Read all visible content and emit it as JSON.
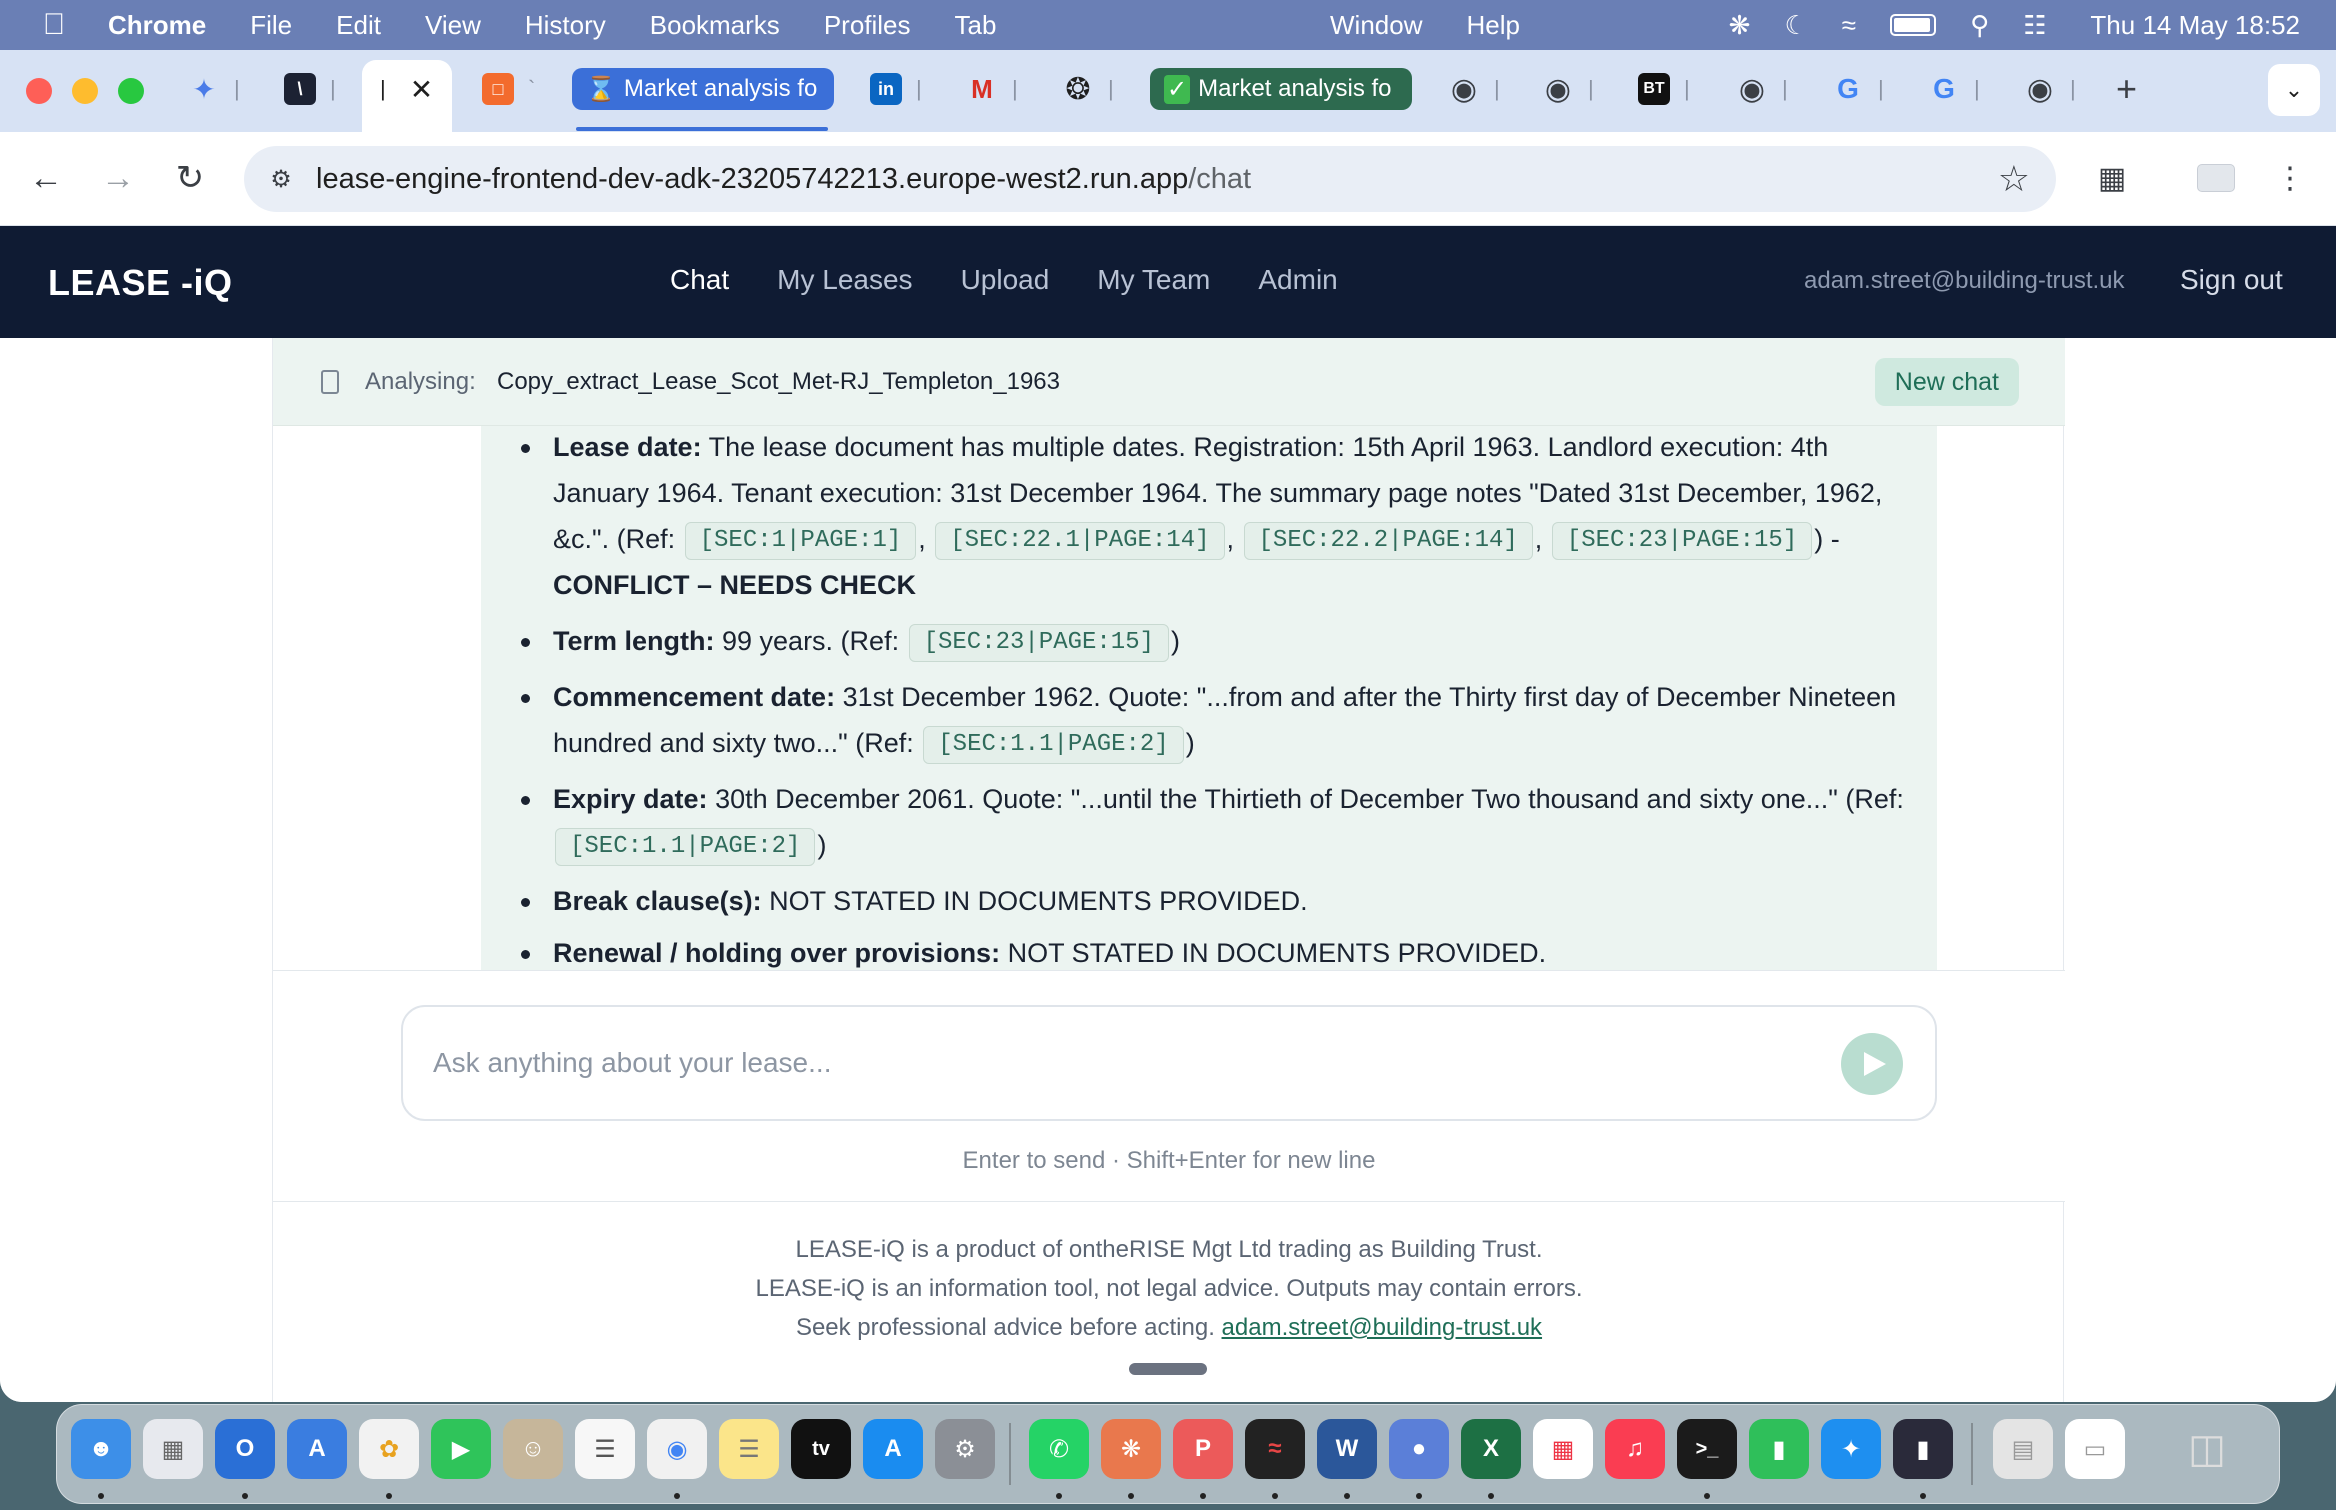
{
  "menubar": {
    "app": "Chrome",
    "items": [
      "File",
      "Edit",
      "View",
      "History",
      "Bookmarks",
      "Profiles",
      "Tab"
    ],
    "window": "Window",
    "help": "Help",
    "clock": "Thu 14 May  18:52"
  },
  "browser": {
    "tabs": [
      {
        "title": "Market analysis fo",
        "icon": "hourglass-icon"
      },
      {
        "title": "Market analysis fo",
        "icon": "check-icon"
      }
    ],
    "url_host": "lease-engine-frontend-dev-adk-23205742213.europe-west2.run.app",
    "url_path": "/chat"
  },
  "app": {
    "logo": "LEASE  -iQ",
    "nav": [
      "Chat",
      "My Leases",
      "Upload",
      "My Team",
      "Admin"
    ],
    "active_nav": "Chat",
    "user_email": "adam.street@building-trust.uk",
    "sign_out": "Sign out"
  },
  "analysis": {
    "label": "Analysing:",
    "filename": "Copy_extract_Lease_Scot_Met-RJ_Templeton_1963",
    "new_chat": "New chat"
  },
  "message": {
    "items": [
      {
        "label": "Lease date:",
        "text": " The lease document has multiple dates. Registration: 15th April 1963. Landlord execution: 4th January 1964. Tenant execution: 31st December 1964. The summary page notes \"Dated 31st December, 1962, &c.\". (Ref: ",
        "refs": [
          "[SEC:1|PAGE:1]",
          "[SEC:22.1|PAGE:14]",
          "[SEC:22.2|PAGE:14]",
          "[SEC:23|PAGE:15]"
        ],
        "after": ") - ",
        "flag": "CONFLICT – NEEDS CHECK"
      },
      {
        "label": "Term length:",
        "text": " 99 years. (Ref: ",
        "refs": [
          "[SEC:23|PAGE:15]"
        ],
        "after": ")"
      },
      {
        "label": "Commencement date:",
        "text": " 31st December 1962. Quote: \"...from and after the Thirty first day of December Nineteen hundred and sixty two...\" (Ref: ",
        "refs": [
          "[SEC:1.1|PAGE:2]"
        ],
        "after": ")"
      },
      {
        "label": "Expiry date:",
        "text": " 30th December 2061. Quote: \"...until the Thirtieth of December Two thousand and sixty one...\" (Ref: ",
        "refs": [
          "[SEC:1.1|PAGE:2]"
        ],
        "after": ")"
      },
      {
        "label": "Break clause(s):",
        "text": " NOT STATED IN DOCUMENTS PROVIDED.",
        "refs": [],
        "after": ""
      },
      {
        "label": "Renewal / holding over provisions:",
        "text": " NOT STATED IN DOCUMENTS PROVIDED.",
        "refs": [],
        "after": ""
      }
    ]
  },
  "composer": {
    "placeholder": "Ask anything about your lease...",
    "hint": "Enter to send · Shift+Enter for new line"
  },
  "footer": {
    "line1": "LEASE-iQ is a product of ontheRISE Mgt Ltd trading as Building Trust.",
    "line2": "LEASE-iQ is an information tool, not legal advice. Outputs may contain errors.",
    "line3": "Seek professional advice before acting.",
    "email": "adam.street@building-trust.uk"
  },
  "colors": {
    "nav_bg": "#0f1b33",
    "accent": "#1f6e57",
    "message_bg": "#ecf4f1"
  }
}
